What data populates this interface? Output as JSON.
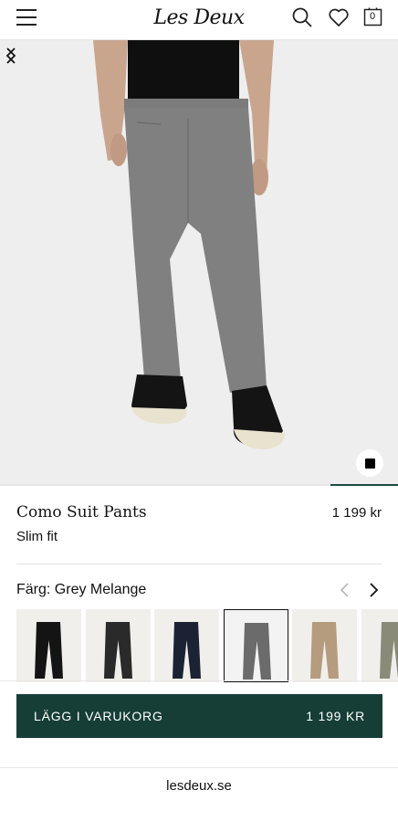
{
  "header": {
    "logo": "Les Deux",
    "cart_count": "0",
    "icons": [
      "menu-icon",
      "search-icon",
      "heart-icon",
      "shopping-bag-icon"
    ]
  },
  "gallery": {
    "image_subject": "model wearing grey trousers and black sneakers",
    "progress": 0.17
  },
  "product": {
    "name": "Como Suit Pants",
    "price": "1 199 kr",
    "fit": "Slim fit"
  },
  "color": {
    "label": "Färg:",
    "value": "Grey Melange",
    "swatches": [
      {
        "color": "#141414",
        "selected": false
      },
      {
        "color": "#2a2a2a",
        "selected": false
      },
      {
        "color": "#1b2233",
        "selected": false
      },
      {
        "color": "#6b6b6b",
        "selected": true
      },
      {
        "color": "#b59c7f",
        "selected": false
      },
      {
        "color": "#8a8a78",
        "selected": false
      }
    ]
  },
  "cta": {
    "label": "LÄGG I VARUKORG",
    "price": "1 199 KR"
  },
  "footer": {
    "domain": "lesdeux.se"
  },
  "colors": {
    "accent": "#163e36",
    "background": "#ffffff"
  }
}
